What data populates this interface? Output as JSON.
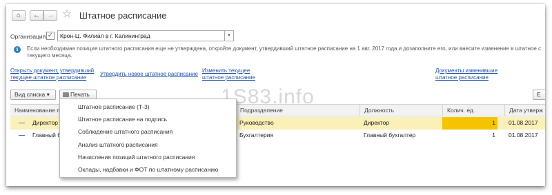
{
  "window": {
    "title": "Штатное расписание",
    "home_glyph": "⌂",
    "back_glyph": "←",
    "forward_glyph": "→",
    "star_glyph": "☆"
  },
  "organization": {
    "label": "Организация:",
    "checked": true,
    "check_glyph": "✓",
    "value": "Крон-Ц. Филиал в г. Калининград",
    "dropdown_glyph": "▾"
  },
  "info": {
    "icon_glyph": "i",
    "text": "Если необходимая позиция штатного расписания еще не утверждена, откройте документ, утвердивший штатное расписание на 1 авг. 2017 года и дозаполните его, или внесите изменение в штатное с текущего месяца."
  },
  "links": {
    "open_document": "Открыть документ, утвердивший текущее штатное расписание",
    "approve_new": "Утвердить новое штатное расписание",
    "change_current": "Изменить текущее штатное расписание",
    "documents_changed": "Документы изменившие штатное расписание"
  },
  "toolbar": {
    "view_list": "Вид списка",
    "view_list_arrow": "▾",
    "print": "Печать",
    "print_arrow": "▾",
    "right_button": "E"
  },
  "watermark": "1S83.info",
  "table": {
    "columns": [
      "Наименование п",
      "Подразделение",
      "Должность",
      "Колич. ед.",
      "Дата утверж"
    ],
    "rows": [
      {
        "dash": "—",
        "name": "Директор /",
        "department": "Руководство",
        "position": "Директор",
        "quantity": "1",
        "date": "01.08.2017"
      },
      {
        "dash": "—",
        "name": "Главный б",
        "department": "Бухгалтерия",
        "position": "Главный бухгалтер",
        "quantity": "1",
        "date": "01.08.2017"
      }
    ]
  },
  "print_menu": {
    "items": [
      "Штатное расписание (Т-3)",
      "Штатное расписание на подпись",
      "Соблюдение штатного расписания",
      "Анализ штатного расписания",
      "Начисления позиций штатного расписания",
      "Оклады, надбавки и ФОТ по штатному расписанию"
    ]
  },
  "colors": {
    "selected_row": "#fbf0b8",
    "selected_cell": "#f5c400",
    "link": "#1d52a8",
    "info_icon": "#2d7fc1"
  }
}
